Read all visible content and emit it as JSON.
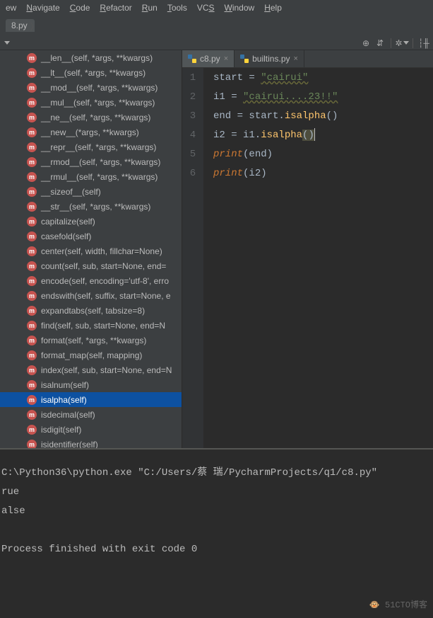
{
  "menu": [
    "ew",
    "Navigate",
    "Code",
    "Refactor",
    "Run",
    "Tools",
    "VCS",
    "Window",
    "Help"
  ],
  "menu_underline_idx": [
    -1,
    0,
    0,
    0,
    0,
    0,
    2,
    0,
    0
  ],
  "crumb": "8.py",
  "tabs": [
    {
      "label": "c8.py",
      "active": true
    },
    {
      "label": "builtins.py",
      "active": false
    }
  ],
  "gutter": [
    "1",
    "2",
    "3",
    "4",
    "5",
    "6"
  ],
  "code": {
    "l1": {
      "a": "start = ",
      "b": "\"cairui\""
    },
    "l2": {
      "a": "i1 = ",
      "b": "\"cairui....23!!\""
    },
    "l3": {
      "a": "end = start.",
      "b": "isalpha",
      "c": "()"
    },
    "l4": {
      "a": "i2 = i1.",
      "b": "isalpha",
      "c": "(",
      ")": ")"
    },
    "l5": {
      "a": "print",
      "b": "(end)"
    },
    "l6": {
      "a": "print",
      "b": "(i2)"
    }
  },
  "methods": [
    {
      "t": "__len__(self, *args, **kwargs)"
    },
    {
      "t": "__lt__(self, *args, **kwargs)"
    },
    {
      "t": "__mod__(self, *args, **kwargs)"
    },
    {
      "t": "__mul__(self, *args, **kwargs)"
    },
    {
      "t": "__ne__(self, *args, **kwargs)"
    },
    {
      "t": "__new__(*args, **kwargs)"
    },
    {
      "t": "__repr__(self, *args, **kwargs)"
    },
    {
      "t": "__rmod__(self, *args, **kwargs)"
    },
    {
      "t": "__rmul__(self, *args, **kwargs)"
    },
    {
      "t": "__sizeof__(self)"
    },
    {
      "t": "__str__(self, *args, **kwargs)"
    },
    {
      "t": "capitalize(self)"
    },
    {
      "t": "casefold(self)"
    },
    {
      "t": "center(self, width, fillchar=None)"
    },
    {
      "t": "count(self, sub, start=None, end="
    },
    {
      "t": "encode(self, encoding='utf-8', erro"
    },
    {
      "t": "endswith(self, suffix, start=None, e"
    },
    {
      "t": "expandtabs(self, tabsize=8)"
    },
    {
      "t": "find(self, sub, start=None, end=N"
    },
    {
      "t": "format(self, *args, **kwargs)"
    },
    {
      "t": "format_map(self, mapping)"
    },
    {
      "t": "index(self, sub, start=None, end=N"
    },
    {
      "t": "isalnum(self)"
    },
    {
      "t": "isalpha(self)",
      "sel": true
    },
    {
      "t": "isdecimal(self)"
    },
    {
      "t": "isdigit(self)"
    },
    {
      "t": "isidentifier(self)"
    }
  ],
  "terminal": [
    "C:\\Python36\\python.exe \"C:/Users/蔡 瑞/PycharmProjects/q1/c8.py\"",
    "rue",
    "alse",
    "",
    "Process finished with exit code 0"
  ],
  "watermark": "🐵 51CTO博客"
}
